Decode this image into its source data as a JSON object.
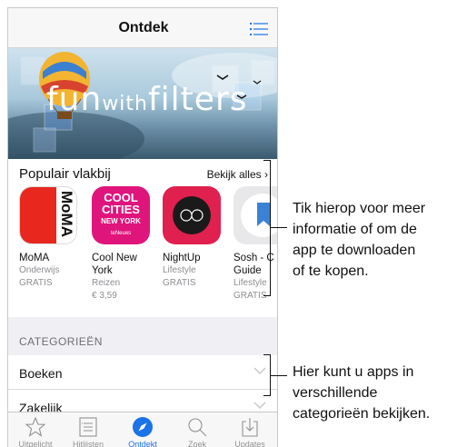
{
  "navbar": {
    "title": "Ontdek",
    "list_icon": "list-icon"
  },
  "banner": {
    "text_large": "fun",
    "text_small": "with",
    "text_end": "filters"
  },
  "popular": {
    "title": "Populair vlakbij",
    "see_all": "Bekijk alles",
    "apps": [
      {
        "name": "MoMA",
        "category": "Onderwijs",
        "price": "GRATIS",
        "icon_text": "MoMA",
        "color": "#e8271f"
      },
      {
        "name": "Cool New York",
        "category": "Reizen",
        "price": "€ 3,59",
        "icon_text": "COOL CITIES",
        "icon_sub": "NEW YORK",
        "icon_brand": "teNeues",
        "color": "#e0157c"
      },
      {
        "name": "NightUp",
        "category": "Lifestyle",
        "price": "GRATIS",
        "color": "#e0204e"
      },
      {
        "name": "Sosh - C Guide",
        "category": "Lifestyle",
        "price": "GRATIS",
        "color": "#e8e8ea"
      }
    ]
  },
  "categories": {
    "header": "CATEGORIEËN",
    "items": [
      {
        "label": "Boeken"
      },
      {
        "label": "Zakelijk"
      }
    ]
  },
  "tabs": [
    {
      "label": "Uitgelicht",
      "icon": "star-icon"
    },
    {
      "label": "Hitlijsten",
      "icon": "list-icon"
    },
    {
      "label": "Ontdekt",
      "icon": "compass-icon",
      "active": true
    },
    {
      "label": "Zoek",
      "icon": "search-icon"
    },
    {
      "label": "Updates",
      "icon": "download-icon"
    }
  ],
  "callouts": {
    "apps_lines": [
      "Tik hierop voor meer",
      "informatie of om de",
      "app te downloaden",
      "of te kopen."
    ],
    "categories_lines": [
      "Hier kunt u apps in",
      "verschillende",
      "categorieën bekijken."
    ]
  },
  "colors": {
    "accent": "#1a73e8",
    "tab_inactive": "#929292"
  }
}
